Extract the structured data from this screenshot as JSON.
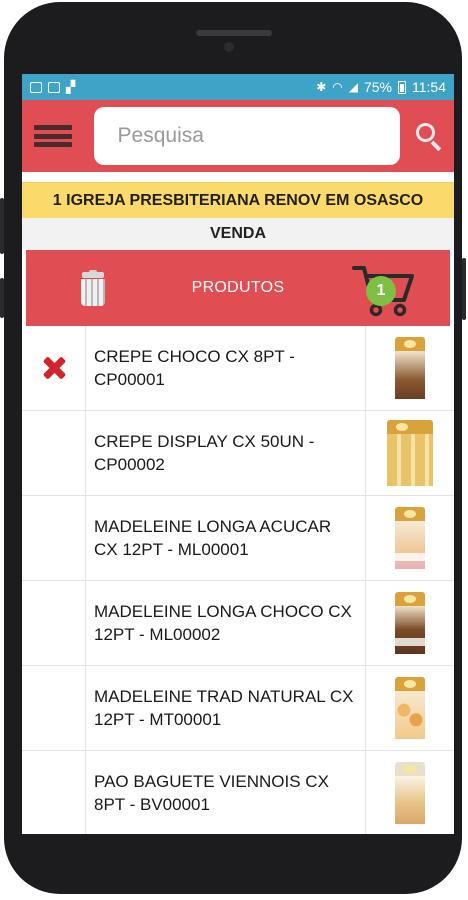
{
  "status_bar": {
    "battery": "75%",
    "time": "11:54"
  },
  "header": {
    "search_placeholder": "Pesquisa"
  },
  "client": {
    "name": "1 IGREJA PRESBITERIANA RENOV EM OSASCO"
  },
  "section": {
    "title": "VENDA"
  },
  "products_bar": {
    "label": "PRODUTOS",
    "cart_count": "1"
  },
  "products": [
    {
      "name": "CREPE CHOCO CX 8PT - CP00001",
      "in_cart": true,
      "image_icon": "crepe-choco-pack-icon"
    },
    {
      "name": "CREPE DISPLAY CX 50UN - CP00002",
      "in_cart": false,
      "image_icon": "crepe-display-box-icon"
    },
    {
      "name": "MADELEINE LONGA ACUCAR CX 12PT - ML00001",
      "in_cart": false,
      "image_icon": "madeleine-acucar-pack-icon"
    },
    {
      "name": "MADELEINE LONGA CHOCO CX 12PT - ML00002",
      "in_cart": false,
      "image_icon": "madeleine-choco-pack-icon"
    },
    {
      "name": "MADELEINE TRAD NATURAL CX 12PT - MT00001",
      "in_cart": false,
      "image_icon": "madeleine-natural-pack-icon"
    },
    {
      "name": "PAO BAGUETE VIENNOIS CX 8PT - BV00001",
      "in_cart": false,
      "image_icon": "pao-baguete-pack-icon"
    }
  ],
  "colors": {
    "status_bar": "#3fa3c7",
    "header_red": "#e04d52",
    "client_bar_yellow": "#fcd96b",
    "remove_red": "#d2242b",
    "cart_badge_green": "#7dc043"
  }
}
